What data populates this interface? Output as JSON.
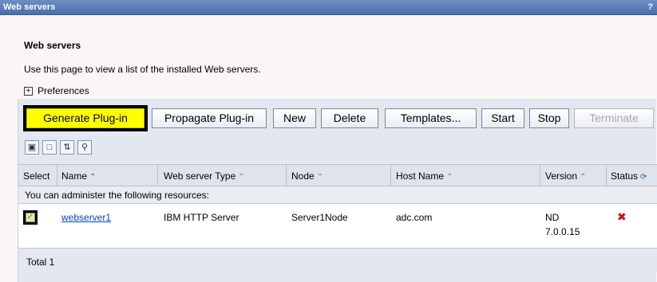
{
  "window": {
    "title": "Web servers",
    "help": "?"
  },
  "page": {
    "heading": "Web servers",
    "description": "Use this page to view a list of the installed Web servers.",
    "preferences_label": "Preferences",
    "preferences_toggle": "+"
  },
  "buttons": {
    "generate_plugin": "Generate Plug-in",
    "propagate_plugin": "Propagate Plug-in",
    "new": "New",
    "delete": "Delete",
    "templates": "Templates...",
    "start": "Start",
    "stop": "Stop",
    "terminate": "Terminate"
  },
  "toolbar_icons": [
    "select-all-icon",
    "deselect-all-icon",
    "show-filter-icon",
    "clear-filter-icon"
  ],
  "table": {
    "columns": {
      "select": "Select",
      "name": "Name",
      "type": "Web server Type",
      "node": "Node",
      "host": "Host Name",
      "version": "Version",
      "status": "Status"
    },
    "resources_caption": "You can administer the following resources:",
    "rows": [
      {
        "selected": true,
        "name": "webserver1",
        "type": "IBM HTTP Server",
        "node": "Server1Node",
        "host": "adc.com",
        "version_line1": "ND",
        "version_line2": "7.0.0.15",
        "status": "✖"
      }
    ],
    "total": "Total 1"
  },
  "colors": {
    "title_bar": "#4a6fac",
    "highlight": "#ffff00",
    "link": "#0044cc",
    "status_stopped": "#cc1111"
  }
}
